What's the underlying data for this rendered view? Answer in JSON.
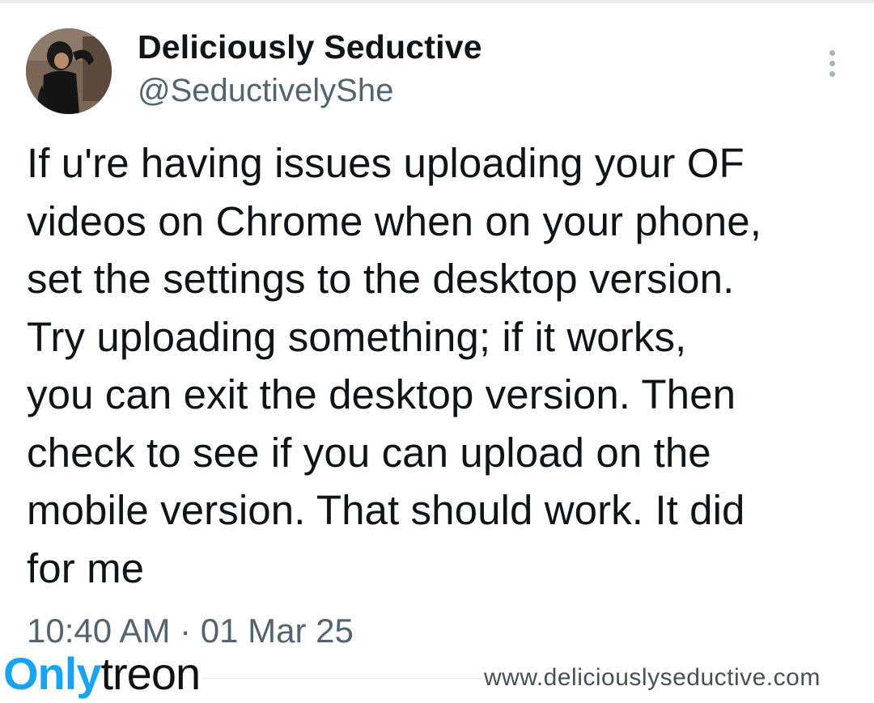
{
  "tweet": {
    "display_name": "Deliciously Seductive",
    "handle": "@SeductivelyShe",
    "text_lines": [
      "If u're having issues uploading your OF",
      "videos on Chrome when on your phone,",
      "set the settings to the desktop version.",
      "Try uploading something; if it works,",
      "you can exit the desktop version. Then",
      "check to see if you can upload on the",
      "mobile version. That should work. It did",
      "for me"
    ],
    "timestamp": "10:40 AM · 01 Mar 25",
    "more_icon": "vertical-ellipsis-icon"
  },
  "watermark": {
    "logo_part1": "Only",
    "logo_part2": "treon",
    "logo_color": "#1aa3f0",
    "url": "www.deliciouslyseductive.com"
  },
  "colors": {
    "text_primary": "#0f1419",
    "text_secondary": "#536471"
  }
}
